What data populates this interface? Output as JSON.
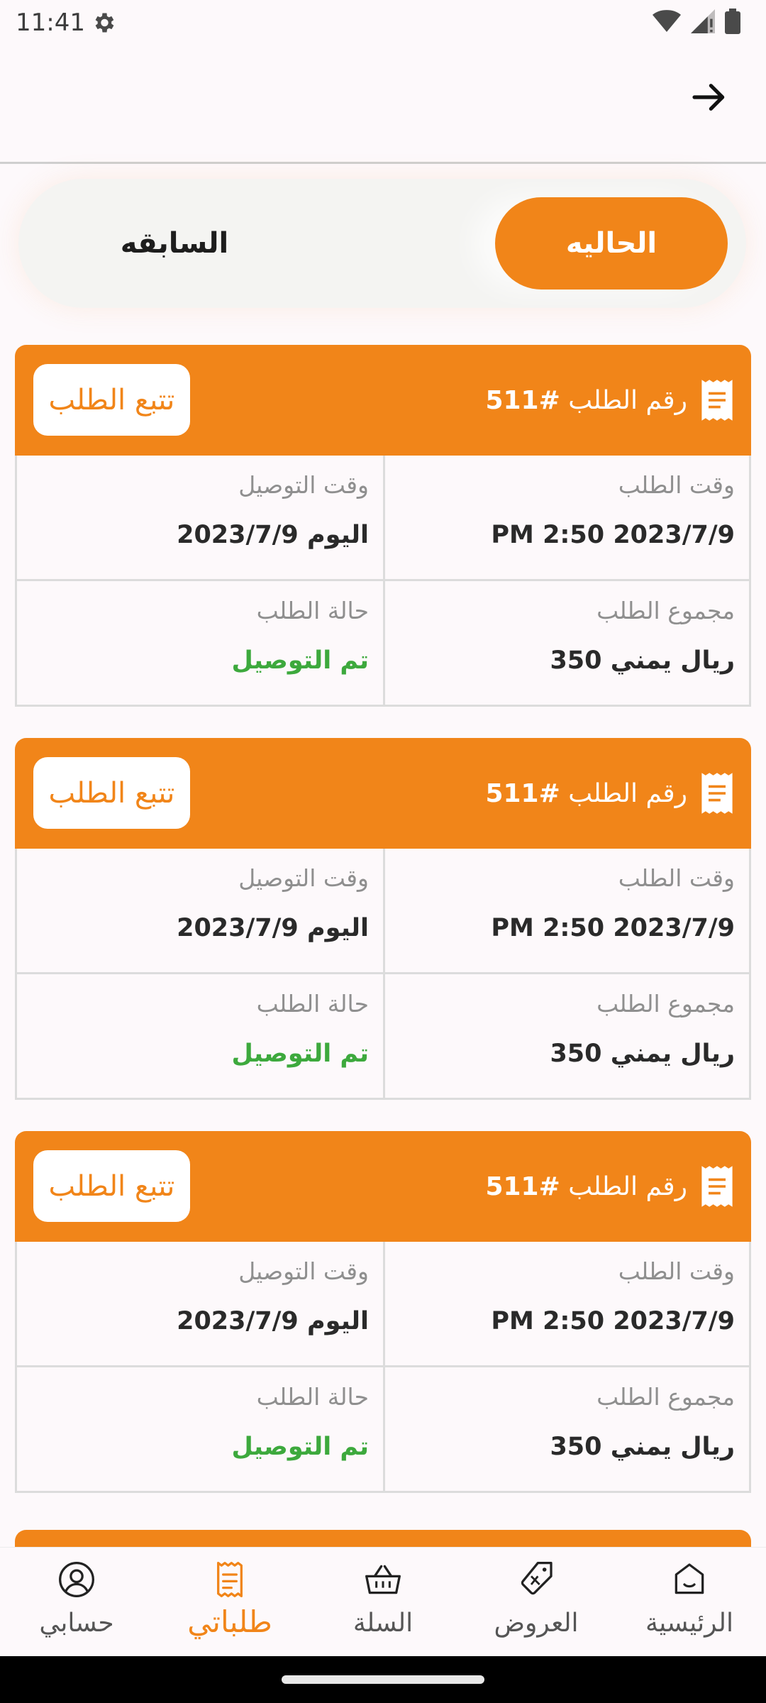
{
  "status_bar": {
    "time": "11:41"
  },
  "tabs": {
    "current": "الحاليه",
    "previous": "السابقه"
  },
  "orders": [
    {
      "track_label": "تتبع الطلب",
      "order_label": "رقم الطلب",
      "order_number": "#511",
      "order_time_label": "وقت الطلب",
      "order_time": "PM 2:50 2023/7/9",
      "delivery_time_label": "وقت التوصيل",
      "delivery_time": "2023/7/9 اليوم",
      "total_label": "مجموع الطلب",
      "total": "350  ريال يمني",
      "status_label": "حالة الطلب",
      "status": "تم التوصيل"
    },
    {
      "track_label": "تتبع الطلب",
      "order_label": "رقم الطلب",
      "order_number": "#511",
      "order_time_label": "وقت الطلب",
      "order_time": "PM 2:50 2023/7/9",
      "delivery_time_label": "وقت التوصيل",
      "delivery_time": "2023/7/9 اليوم",
      "total_label": "مجموع الطلب",
      "total": "350  ريال يمني",
      "status_label": "حالة الطلب",
      "status": "تم التوصيل"
    },
    {
      "track_label": "تتبع الطلب",
      "order_label": "رقم الطلب",
      "order_number": "#511",
      "order_time_label": "وقت الطلب",
      "order_time": "PM 2:50 2023/7/9",
      "delivery_time_label": "وقت التوصيل",
      "delivery_time": "2023/7/9 اليوم",
      "total_label": "مجموع الطلب",
      "total": "350  ريال يمني",
      "status_label": "حالة الطلب",
      "status": "تم التوصيل"
    }
  ],
  "bottom_nav": {
    "home": "الرئيسية",
    "offers": "العروض",
    "cart": "السلة",
    "orders": "طلباتي",
    "account": "حسابي"
  },
  "colors": {
    "accent": "#f18519",
    "delivered": "#3da93d",
    "background": "#fdf9fb"
  }
}
